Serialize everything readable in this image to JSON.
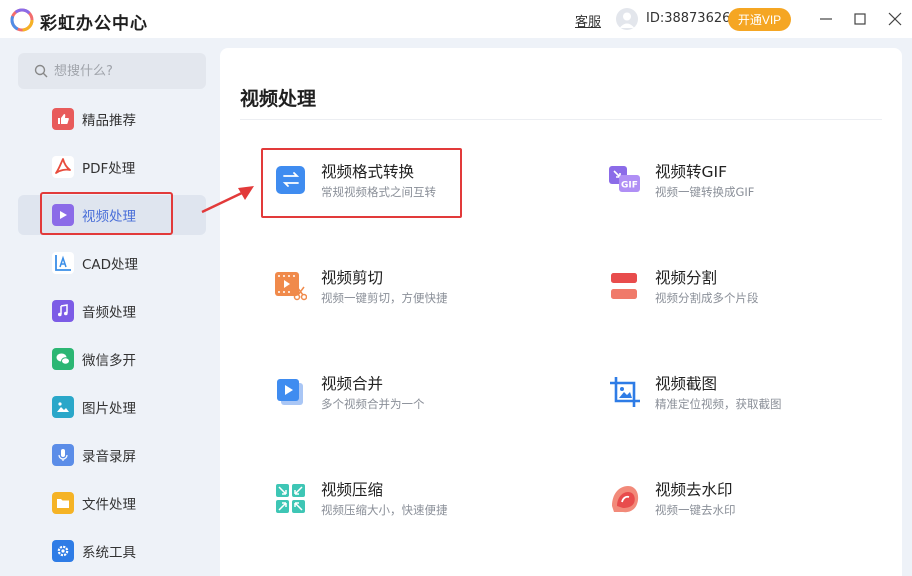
{
  "app": {
    "title": "彩虹办公中心",
    "kefu_label": "客服",
    "user_id": "ID:38873626",
    "vip_label": "开通VIP"
  },
  "sidebar": {
    "search_placeholder": "想搜什么?",
    "items": [
      {
        "label": "精品推荐",
        "icon": "thumbs-up-icon",
        "color": "#e85b5b"
      },
      {
        "label": "PDF处理",
        "icon": "pdf-icon",
        "color": "#e84c3d"
      },
      {
        "label": "视频处理",
        "icon": "play-icon",
        "color": "#8b6be8",
        "active": true
      },
      {
        "label": "CAD处理",
        "icon": "cad-icon",
        "color": "#3a8ee8"
      },
      {
        "label": "音频处理",
        "icon": "music-icon",
        "color": "#7c5ce6"
      },
      {
        "label": "微信多开",
        "icon": "wechat-icon",
        "color": "#2bb673"
      },
      {
        "label": "图片处理",
        "icon": "image-icon",
        "color": "#2aa7c9"
      },
      {
        "label": "录音录屏",
        "icon": "microphone-icon",
        "color": "#5b8de8"
      },
      {
        "label": "文件处理",
        "icon": "folder-icon",
        "color": "#f5b325"
      },
      {
        "label": "系统工具",
        "icon": "gear-icon",
        "color": "#2e7ce6"
      }
    ]
  },
  "main": {
    "title": "视频处理",
    "features": [
      {
        "name": "视频格式转换",
        "desc": "常规视频格式之间互转",
        "icon": "convert-icon"
      },
      {
        "name": "视频转GIF",
        "desc": "视频一键转换成GIF",
        "icon": "gif-icon"
      },
      {
        "name": "视频剪切",
        "desc": "视频一键剪切，方便快捷",
        "icon": "scissors-icon"
      },
      {
        "name": "视频分割",
        "desc": "视频分割成多个片段",
        "icon": "split-icon"
      },
      {
        "name": "视频合并",
        "desc": "多个视频合并为一个",
        "icon": "merge-icon"
      },
      {
        "name": "视频截图",
        "desc": "精准定位视频，获取截图",
        "icon": "crop-icon"
      },
      {
        "name": "视频压缩",
        "desc": "视频压缩大小，快速便捷",
        "icon": "compress-icon"
      },
      {
        "name": "视频去水印",
        "desc": "视频一键去水印",
        "icon": "eraser-icon"
      }
    ]
  },
  "colors": {
    "accent": "#4a6fd8",
    "vip": "#f5a623",
    "highlight": "#e23a3a"
  }
}
